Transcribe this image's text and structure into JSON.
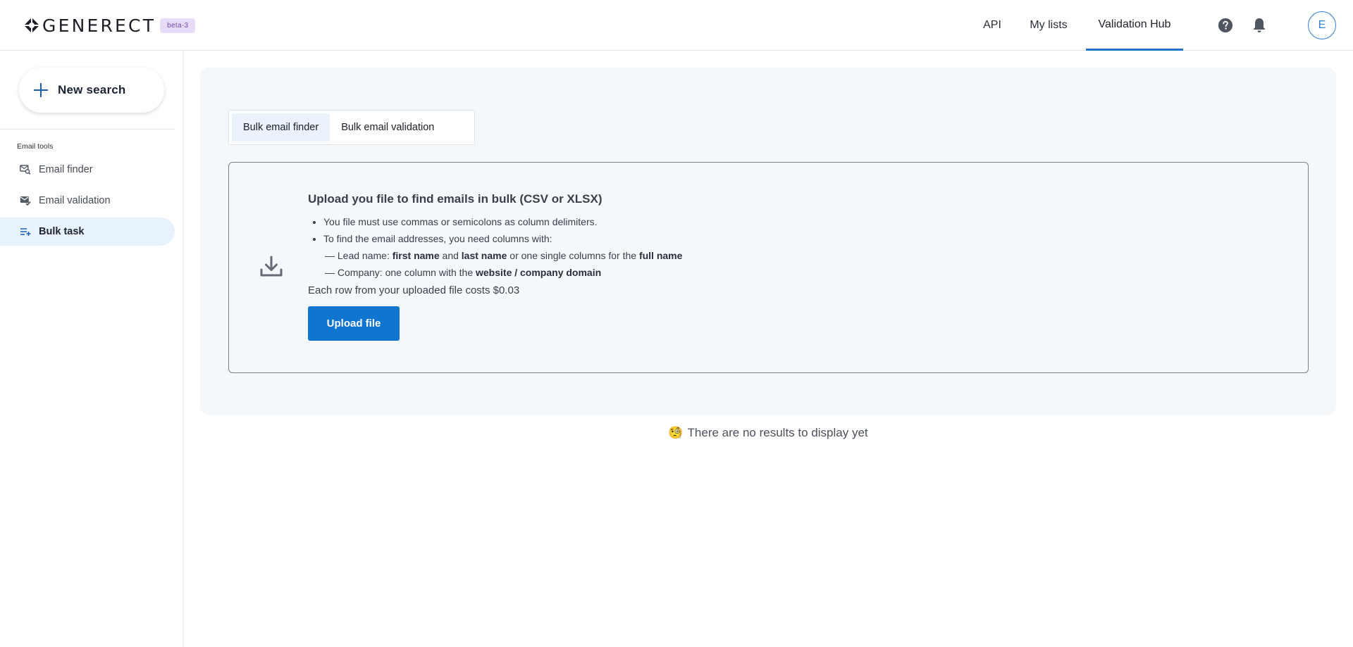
{
  "header": {
    "logo_text": "GENERECT",
    "beta_badge": "beta-3",
    "nav": [
      {
        "label": "API"
      },
      {
        "label": "My lists"
      },
      {
        "label": "Validation Hub",
        "active": true
      }
    ],
    "avatar_initial": "E"
  },
  "sidebar": {
    "new_search_label": "New search",
    "section_label": "Email tools",
    "items": [
      {
        "label": "Email finder",
        "icon": "email-search-icon"
      },
      {
        "label": "Email validation",
        "icon": "email-check-icon"
      },
      {
        "label": "Bulk task",
        "icon": "playlist-add-icon",
        "active": true
      }
    ]
  },
  "main": {
    "tabs": [
      {
        "label": "Bulk email finder",
        "active": true
      },
      {
        "label": "Bulk email validation"
      }
    ],
    "upload": {
      "title": "Upload you file to find emails in bulk (CSV or XLSX)",
      "bullet_1": "You file must use commas or semicolons as column delimiters.",
      "bullet_2": "To find the email addresses, you need columns with:",
      "lead_prefix": "— Lead name: ",
      "lead_first": "first name",
      "lead_and": " and ",
      "lead_last": "last name",
      "lead_or": " or one single columns for the ",
      "lead_full": "full name",
      "company_prefix": "— Company: one column with the ",
      "company_domain": "website / company domain",
      "cost_text": "Each row from your uploaded file costs $0.03",
      "button_label": "Upload file"
    },
    "empty_emoji": "🧐",
    "empty_text": "There are no results to display yet"
  },
  "colors": {
    "accent": "#1075cf",
    "active_bg": "#e8f2fc",
    "panel_bg": "#f5f8fb"
  }
}
